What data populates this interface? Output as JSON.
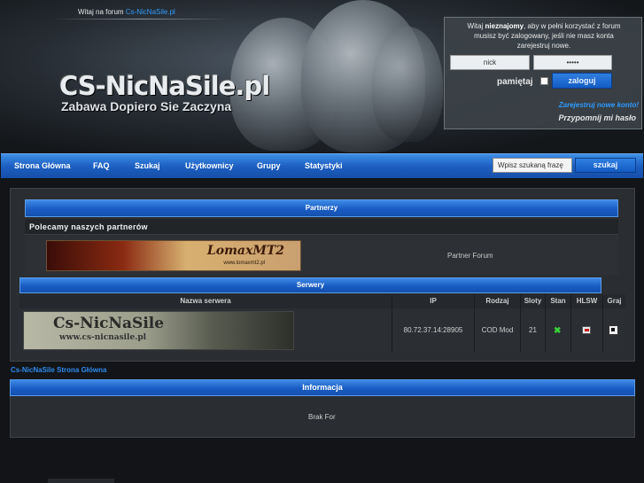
{
  "header": {
    "welcome_prefix": "Witaj na forum",
    "welcome_link": "Cs-NicNaSile.pl",
    "logo_title": "CS-NicNaSile.pl",
    "logo_subtitle": "Zabawa Dopiero Sie Zaczyna"
  },
  "login": {
    "info_line1_a": "Witaj",
    "info_line1_b": "nieznajomy",
    "info_line1_c": ", aby w pełni korzystać z forum",
    "info_line2": "musisz być zalogowany, jeśli nie masz konta",
    "info_line3": "zarejestruj nowe.",
    "username_value": "nick",
    "password_value": "•••••",
    "remember_label": "pamiętaj",
    "login_button": "zaloguj",
    "register_link": "Zarejestruj nowe konto!",
    "remind_link": "Przypomnij mi hasło"
  },
  "nav": {
    "items": [
      "Strona Główna",
      "FAQ",
      "Szukaj",
      "Użytkownicy",
      "Grupy",
      "Statystyki"
    ],
    "search_placeholder": "Wpisz szukaną frazę",
    "search_button": "szukaj"
  },
  "partners": {
    "bar_title": "Partnerzy",
    "heading": "Polecamy naszych partnerów",
    "banner_name": "LomaxMT2",
    "banner_url": "www.lomaxmt2.pl",
    "label": "Partner Forum"
  },
  "servers": {
    "bar_title": "Serwery",
    "columns": [
      "Nazwa serwera",
      "IP",
      "Rodzaj",
      "Sloty",
      "Stan",
      "HLSW",
      "Graj"
    ],
    "rows": [
      {
        "banner_name": "Cs-NicNaSile",
        "banner_url": "www.cs-nicnasile.pl",
        "ip": "80.72.37.14:28905",
        "type": "COD Mod",
        "slots": "21",
        "status": "✖"
      }
    ]
  },
  "breadcrumb": "Cs-NicNaSile Strona Główna",
  "info": {
    "bar_title": "Informacja",
    "body": "Brak For"
  },
  "colors": {
    "accent_blue": "#1d5fc2",
    "link_blue": "#2f9bff",
    "status_green": "#3ad33a"
  }
}
